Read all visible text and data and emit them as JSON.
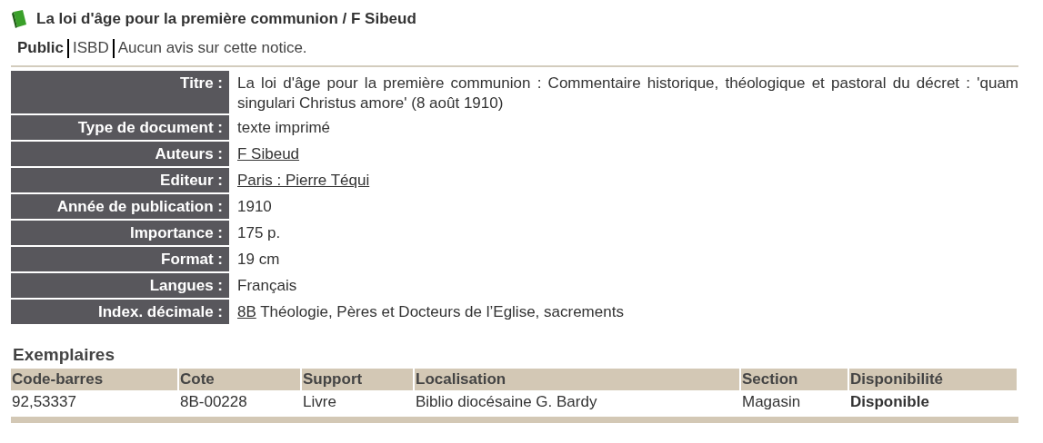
{
  "title": "La loi d'âge pour la première communion / F Sibeud",
  "tabs": [
    {
      "label": "Public",
      "selected": true
    },
    {
      "label": "ISBD",
      "selected": false
    }
  ],
  "review_note": "Aucun avis sur cette notice.",
  "fields": [
    {
      "label": "Titre :",
      "parts": [
        {
          "text": "La loi d'âge pour la première communion : Commentaire historique, théologique et pastoral du décret : 'quam singulari Christus amore' (8 août 1910)",
          "link": false
        }
      ]
    },
    {
      "label": "Type de document :",
      "parts": [
        {
          "text": "texte imprimé",
          "link": false
        }
      ]
    },
    {
      "label": "Auteurs :",
      "parts": [
        {
          "text": "F Sibeud",
          "link": true
        }
      ]
    },
    {
      "label": "Editeur :",
      "parts": [
        {
          "text": "Paris : Pierre Téqui",
          "link": true
        }
      ]
    },
    {
      "label": "Année de publication :",
      "parts": [
        {
          "text": "1910",
          "link": false
        }
      ]
    },
    {
      "label": "Importance :",
      "parts": [
        {
          "text": "175 p.",
          "link": false
        }
      ]
    },
    {
      "label": "Format :",
      "parts": [
        {
          "text": "19 cm",
          "link": false
        }
      ]
    },
    {
      "label": "Langues :",
      "parts": [
        {
          "text": "Français",
          "link": false
        }
      ]
    },
    {
      "label": "Index. décimale :",
      "parts": [
        {
          "text": "8B",
          "link": true
        },
        {
          "text": "Théologie, Pères et Docteurs de l’Eglise, sacrements",
          "link": false
        }
      ]
    }
  ],
  "copies": {
    "heading": "Exemplaires",
    "columns": [
      "Code-barres",
      "Cote",
      "Support",
      "Localisation",
      "Section",
      "Disponibilité"
    ],
    "rows": [
      [
        "92,53337",
        "8B-00228",
        "Livre",
        "Biblio diocésaine G. Bardy",
        "Magasin",
        "Disponible"
      ]
    ]
  }
}
